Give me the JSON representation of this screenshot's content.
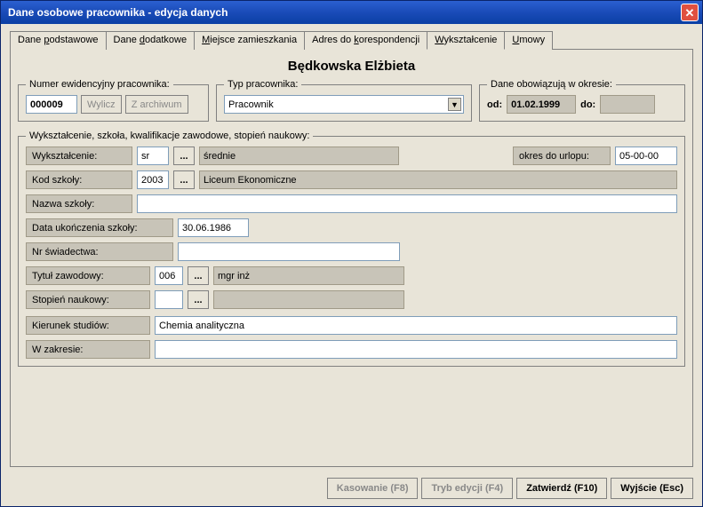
{
  "window": {
    "title": "Dane osobowe pracownika - edycja danych"
  },
  "tabs": [
    {
      "label_pre": "Dane ",
      "ul": "p",
      "label_post": "odstawowe"
    },
    {
      "label_pre": "Dane ",
      "ul": "d",
      "label_post": "odatkowe"
    },
    {
      "label_pre": "",
      "ul": "M",
      "label_post": "iejsce zamieszkania"
    },
    {
      "label_pre": "Adres do ",
      "ul": "k",
      "label_post": "orespondencji"
    },
    {
      "label_pre": "",
      "ul": "W",
      "label_post": "ykształcenie"
    },
    {
      "label_pre": "",
      "ul": "U",
      "label_post": "mowy"
    }
  ],
  "person_name": "Będkowska Elżbieta",
  "numbox": {
    "legend": "Numer ewidencyjny pracownika:",
    "number": "000009",
    "btn_calc": "Wylicz",
    "btn_archive": "Z archiwum"
  },
  "typebox": {
    "legend": "Typ pracownika:",
    "selected": "Pracownik"
  },
  "datebox": {
    "legend": "Dane obowiązują w okresie:",
    "from_lbl": "od:",
    "from_val": "01.02.1999",
    "to_lbl": "do:",
    "to_val": ""
  },
  "edu": {
    "legend": "Wykształcenie, szkoła, kwalifikacje zawodowe, stopień naukowy:",
    "edulevel_lbl": "Wykształcenie:",
    "edulevel_code": "sr",
    "edulevel_name": "średnie",
    "leave_lbl": "okres do urlopu:",
    "leave_val": "05-00-00",
    "schoolcode_lbl": "Kod szkoły:",
    "schoolcode_val": "2003",
    "schoolcode_name": "Liceum Ekonomiczne",
    "schoolname_lbl": "Nazwa szkoły:",
    "schoolname_val": "",
    "graddate_lbl": "Data ukończenia szkoły:",
    "graddate_val": "30.06.1986",
    "certnum_lbl": "Nr świadectwa:",
    "certnum_val": "",
    "title_lbl": "Tytuł zawodowy:",
    "title_code": "006",
    "title_name": "mgr inż",
    "degree_lbl": "Stopień naukowy:",
    "degree_code": "",
    "degree_name": "",
    "major_lbl": "Kierunek studiów:",
    "major_val": "Chemia analityczna",
    "scope_lbl": "W zakresie:",
    "scope_val": ""
  },
  "buttons": {
    "delete": "Kasowanie (F8)",
    "editmode": "Tryb edycji (F4)",
    "confirm": "Zatwierdź (F10)",
    "exit": "Wyjście (Esc)"
  }
}
